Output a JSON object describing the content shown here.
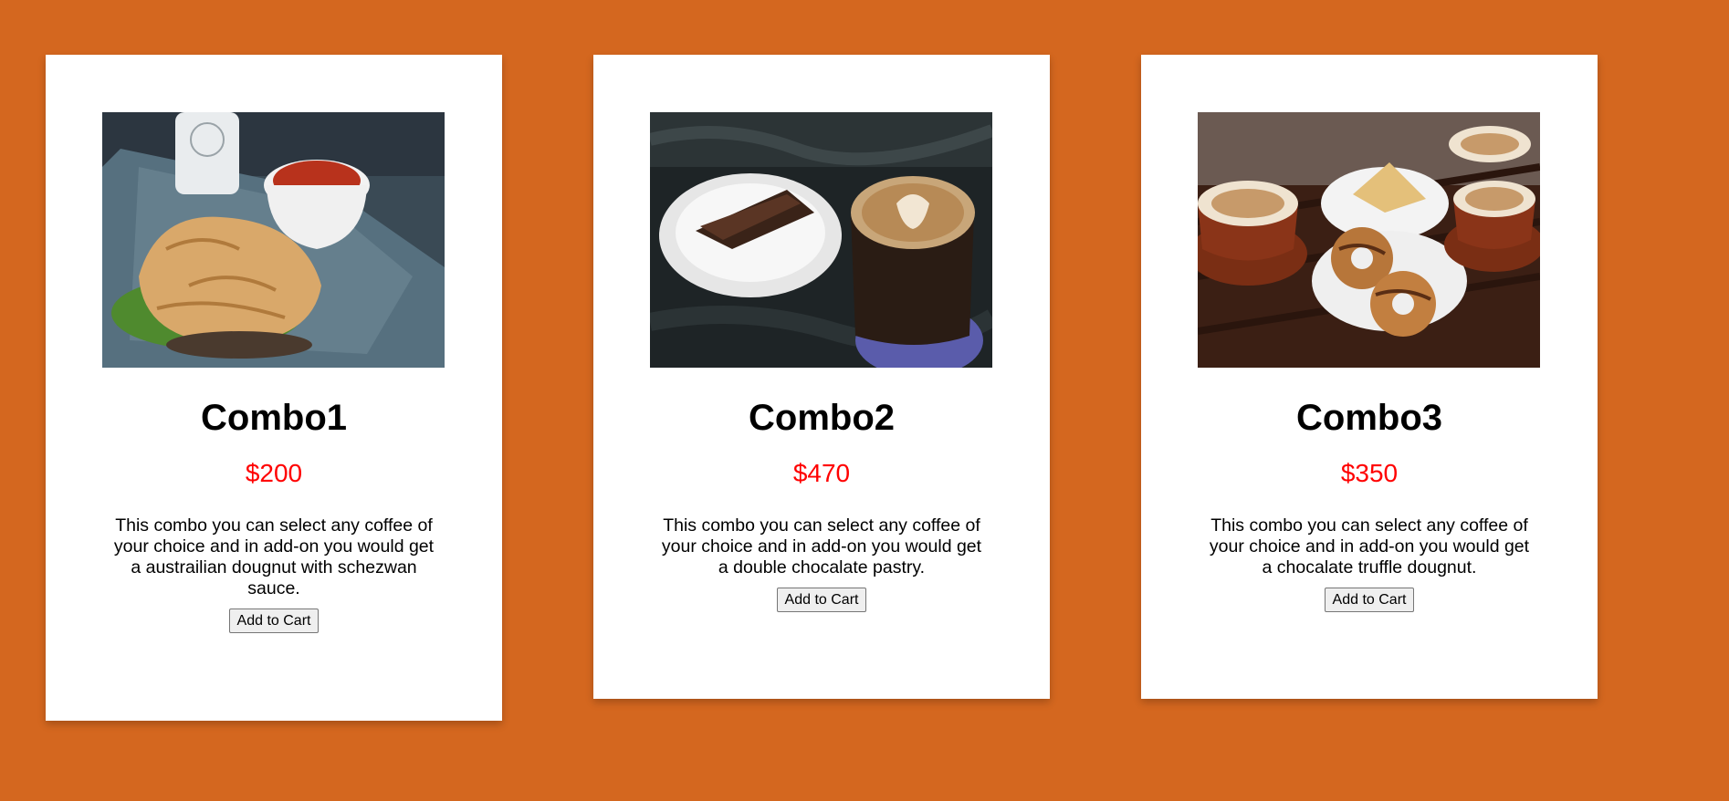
{
  "products": [
    {
      "title": "Combo1",
      "price": "$200",
      "description": "This combo you can select any coffee of your choice and in add-on you would get a austrailian dougnut with schezwan sauce.",
      "button_label": "Add to Cart",
      "image": "sandwich-and-soup-photo"
    },
    {
      "title": "Combo2",
      "price": "$470",
      "description": "This combo you can select any coffee of your choice and in add-on you would get a double chocalate pastry.",
      "button_label": "Add to Cart",
      "image": "pastry-and-latte-photo"
    },
    {
      "title": "Combo3",
      "price": "$350",
      "description": "This combo you can select any coffee of your choice and in add-on you would get a chocalate truffle dougnut.",
      "button_label": "Add to Cart",
      "image": "cappuccinos-and-doughnuts-photo"
    }
  ],
  "colors": {
    "background": "#d4671f",
    "card": "#ffffff",
    "price": "#ff0000"
  }
}
